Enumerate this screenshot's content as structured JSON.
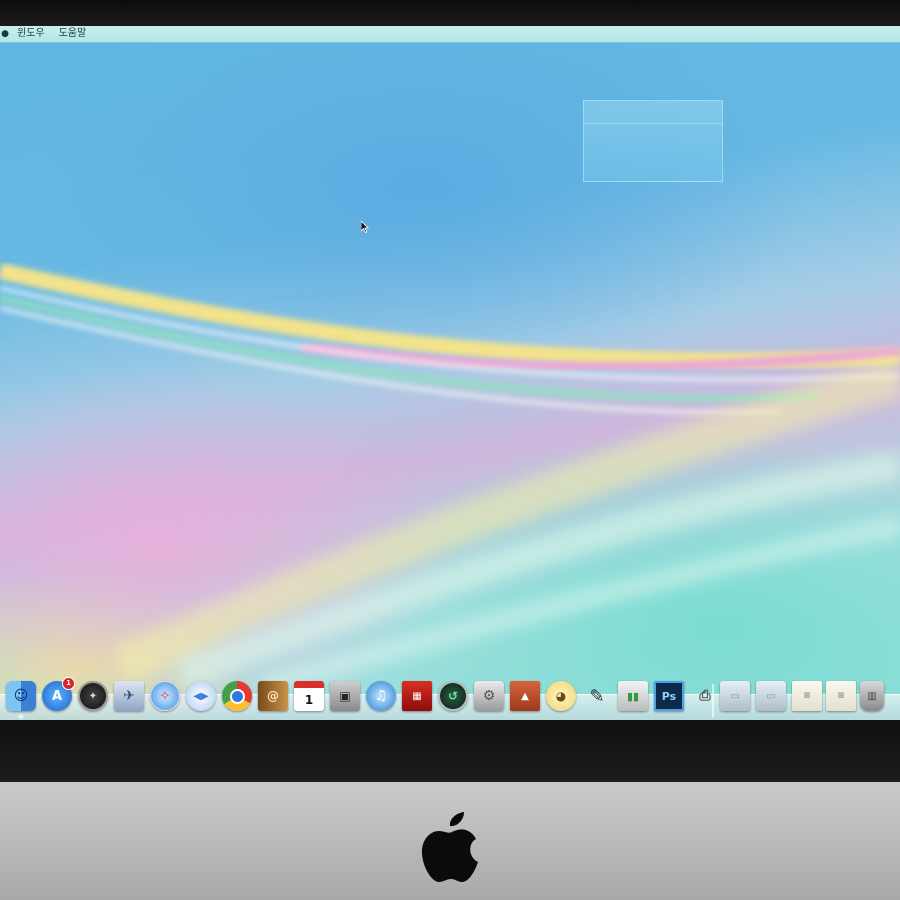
{
  "menubar": {
    "apple_icon": "apple-menu-icon",
    "items": [
      "윈도우",
      "도움말"
    ]
  },
  "dock": {
    "badge_app_store": "1",
    "calendar_day": "1",
    "photoshop_label": "Ps",
    "items": [
      {
        "name": "finder",
        "icon": "finder-icon"
      },
      {
        "name": "app-store",
        "icon": "app-store-icon"
      },
      {
        "name": "dashboard",
        "icon": "dashboard-icon"
      },
      {
        "name": "launchpad",
        "icon": "launchpad-icon"
      },
      {
        "name": "safari",
        "icon": "safari-icon"
      },
      {
        "name": "messages",
        "icon": "messages-icon"
      },
      {
        "name": "chrome",
        "icon": "chrome-icon"
      },
      {
        "name": "contacts",
        "icon": "contacts-icon"
      },
      {
        "name": "calendar",
        "icon": "calendar-icon"
      },
      {
        "name": "photo-booth",
        "icon": "photo-booth-icon"
      },
      {
        "name": "itunes",
        "icon": "itunes-icon"
      },
      {
        "name": "photo-booth-film",
        "icon": "film-icon"
      },
      {
        "name": "time-machine",
        "icon": "time-machine-icon"
      },
      {
        "name": "system-preferences",
        "icon": "system-preferences-icon"
      },
      {
        "name": "keynote",
        "icon": "keynote-icon"
      },
      {
        "name": "cyberduck",
        "icon": "duck-icon"
      },
      {
        "name": "script-editor",
        "icon": "script-editor-icon"
      },
      {
        "name": "numbers",
        "icon": "numbers-icon"
      },
      {
        "name": "photoshop",
        "icon": "photoshop-icon"
      },
      {
        "name": "printer",
        "icon": "printer-icon"
      },
      {
        "name": "applications-folder",
        "icon": "folder-icon"
      },
      {
        "name": "documents-folder",
        "icon": "folder-icon"
      },
      {
        "name": "document-stack",
        "icon": "document-icon"
      },
      {
        "name": "downloads-stack",
        "icon": "document-icon"
      },
      {
        "name": "trash",
        "icon": "trash-icon"
      }
    ]
  },
  "colors": {
    "menubar": "#bfeceb",
    "screen_blue": "#62b8e4",
    "rainbow_yellow": "#f3e38a",
    "rainbow_pink": "#e9a8d6",
    "rainbow_teal": "#7fdcd2",
    "bezel": "#141416",
    "chin": "#bdbdbd"
  }
}
